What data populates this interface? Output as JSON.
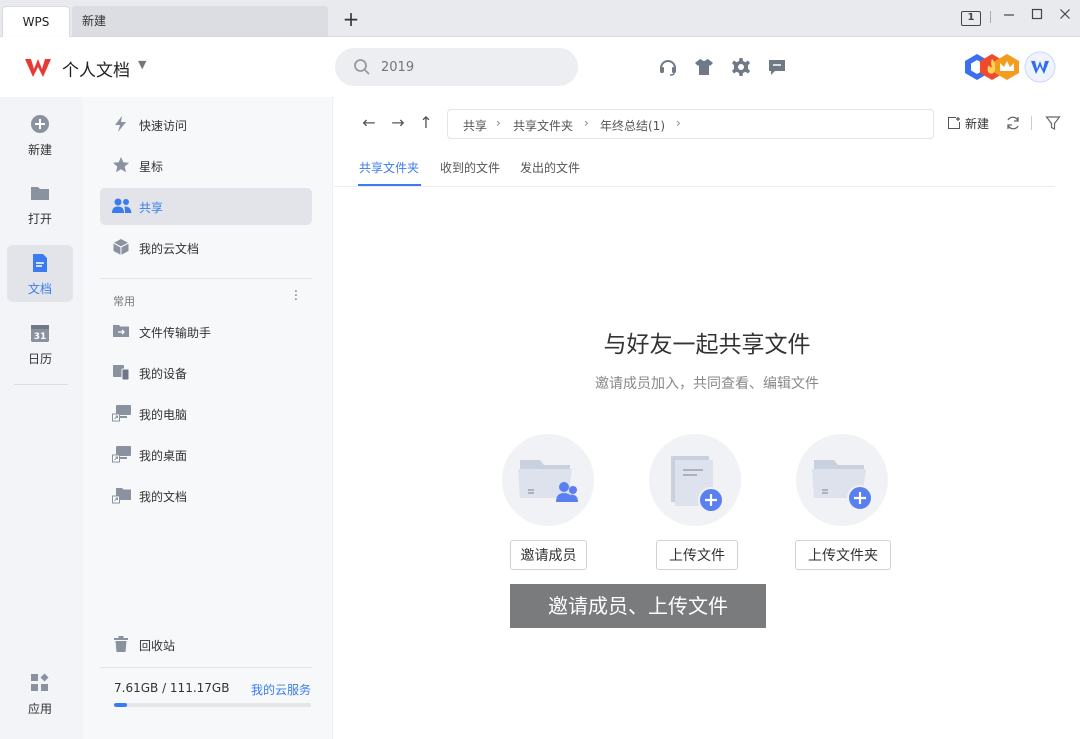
{
  "tabs": {
    "wps": "WPS",
    "new_tab": "新建",
    "add": "+"
  },
  "window": {
    "badge": "1"
  },
  "header": {
    "workspace": "个人文档",
    "search_placeholder": "2019"
  },
  "leftnav": [
    {
      "label": "新建"
    },
    {
      "label": "打开"
    },
    {
      "label": "文档"
    },
    {
      "label": "日历"
    }
  ],
  "leftnav_apps": "应用",
  "sidebar": {
    "top_items": [
      {
        "label": "快速访问"
      },
      {
        "label": "星标"
      },
      {
        "label": "共享"
      },
      {
        "label": "我的云文档"
      }
    ],
    "section_title": "常用",
    "common_items": [
      {
        "label": "文件传输助手"
      },
      {
        "label": "我的设备"
      },
      {
        "label": "我的电脑"
      },
      {
        "label": "我的桌面"
      },
      {
        "label": "我的文档"
      }
    ],
    "recycle": "回收站",
    "storage": {
      "text": "7.61GB / 111.17GB",
      "link": "我的云服务",
      "used_fraction": 0.068
    }
  },
  "main": {
    "breadcrumb": [
      "共享",
      "共享文件夹",
      "年终总结(1)"
    ],
    "new_label": "新建",
    "content_tabs": [
      "共享文件夹",
      "收到的文件",
      "发出的文件"
    ],
    "empty_title": "与好友一起共享文件",
    "empty_subtitle": "邀请成员加入，共同查看、编辑文件",
    "actions": [
      {
        "label": "邀请成员"
      },
      {
        "label": "上传文件"
      },
      {
        "label": "上传文件夹"
      }
    ],
    "tooltip": "邀请成员、上传文件"
  },
  "colors": {
    "accent": "#3a7cf0",
    "active_bg": "#e2e4ea",
    "brand_red": "#e83a32"
  }
}
